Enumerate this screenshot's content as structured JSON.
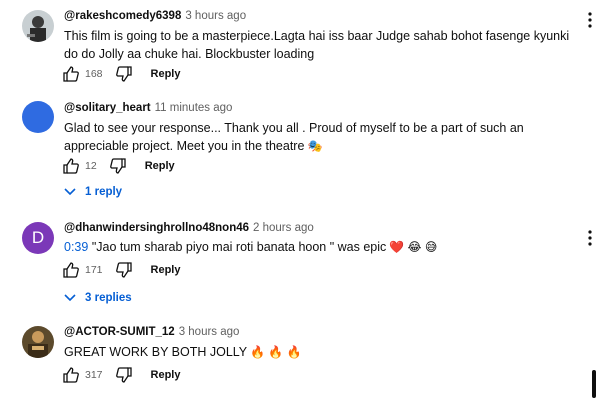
{
  "comments": [
    {
      "handle": "@rakeshcomedy6398",
      "time": "3 hours ago",
      "text": "This film is going to be a masterpiece.Lagta hai iss baar Judge sahab bohot fasenge kyunki do do Jolly aa chuke hai. Blockbuster loading",
      "likes": "168",
      "reply_label": "Reply",
      "avatar_color": "#5a6a6a"
    },
    {
      "handle": "@solitary_heart",
      "time": "11 minutes ago",
      "text": "Glad to see your response... Thank you all . Proud of myself to be a part of such an appreciable project. Meet you in the theatre",
      "emoji": "🎭",
      "likes": "12",
      "reply_label": "Reply",
      "replies_label": "1 reply",
      "avatar_color": "#2f6be1"
    },
    {
      "handle": "@dhanwindersinghrollno48non46",
      "time": "2 hours ago",
      "timestamp_link": "0:39",
      "text": " \"Jao tum sharab piyo mai roti banata hoon \" was epic",
      "emoji": "❤️ 😂 😅",
      "avatar_letter": "D",
      "likes": "171",
      "reply_label": "Reply",
      "replies_label": "3 replies",
      "avatar_color": "#7b38b8"
    },
    {
      "handle": "@ACTOR-SUMIT_12",
      "time": "3 hours ago",
      "text": "GREAT WORK BY BOTH JOLLY",
      "emoji": "🔥 🔥 🔥",
      "likes": "317",
      "reply_label": "Reply",
      "avatar_color": "#6b5a3a"
    }
  ],
  "colors": {
    "link_blue": "#065fd4",
    "secondary_text": "#606060",
    "primary_text": "#0f0f0f"
  }
}
